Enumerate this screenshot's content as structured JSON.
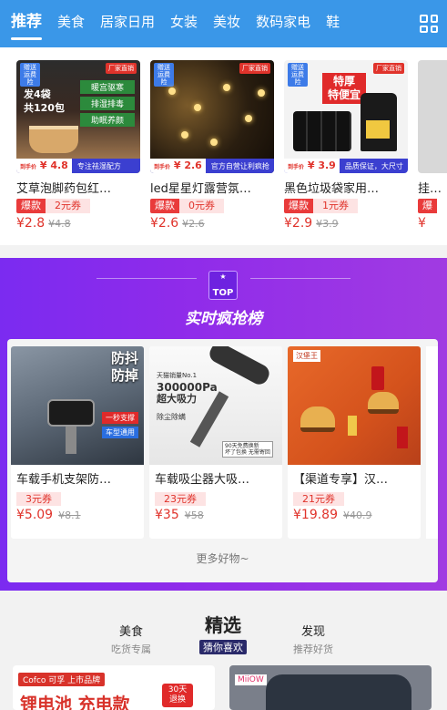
{
  "topnav": {
    "tabs": [
      "推荐",
      "美食",
      "居家日用",
      "女装",
      "美妆",
      "数码家电",
      "鞋"
    ],
    "active": "推荐",
    "grid_icon": "grid-menu-icon"
  },
  "products": [
    {
      "title": "艾草泡脚药包红…",
      "img_lines": [
        "发4袋",
        "共120包"
      ],
      "img_tags": [
        "暖宫驱寒",
        "排湿排毒",
        "助眠养颜"
      ],
      "img_badge_left": "赠送运费险",
      "img_badge_right": "厂家直销",
      "img_price_prefix": "到手价",
      "img_price": "¥ 4.8",
      "img_slogan": "专注祛湿配方",
      "hot": "爆款",
      "coupon": "2元券",
      "price": "¥2.8",
      "old_price": "¥4.8"
    },
    {
      "title": "led星星灯露营氛…",
      "img_badge_left": "赠送运费险",
      "img_badge_right": "厂家直销",
      "img_price_prefix": "到手价",
      "img_price": "¥ 2.6",
      "img_slogan": "官方自营让利疯抢",
      "hot": "爆款",
      "coupon": "0元券",
      "price": "¥2.6",
      "old_price": "¥2.6"
    },
    {
      "title": "黑色垃圾袋家用…",
      "img_lines": [
        "特厚",
        "特便宜"
      ],
      "img_badge_left": "赠送运费险",
      "img_badge_right": "厂家直销",
      "img_price_prefix": "到手价",
      "img_price": "¥ 3.9",
      "img_slogan": "品质保证，大尺寸",
      "hot": "爆款",
      "coupon": "1元券",
      "price": "¥2.9",
      "old_price": "¥3.9"
    },
    {
      "title": "挂…",
      "hot": "爆",
      "price": "¥"
    }
  ],
  "ranking": {
    "badge_top": "TOP",
    "title": "实时疯抢榜",
    "items": [
      {
        "title": "车载手机支架防…",
        "img_text": [
          "防抖",
          "防掉"
        ],
        "img_tags": [
          "一秒支撑",
          "车型通用"
        ],
        "coupon": "3元券",
        "price": "¥5.09",
        "old_price": "¥8.1"
      },
      {
        "title": "车载吸尘器大吸…",
        "img_text": [
          "天猫销量No.1",
          "300000Pa",
          "超大吸力",
          "除尘除螨",
          "90天免费换新",
          "坏了包换 无需寄回"
        ],
        "coupon": "23元券",
        "price": "¥35",
        "old_price": "¥58"
      },
      {
        "title": "【渠道专享】汉…",
        "img_text": [
          "汉堡王"
        ],
        "coupon": "21元券",
        "price": "¥19.89",
        "old_price": "¥40.9"
      }
    ],
    "more": "更多好物~"
  },
  "feed_tabs": [
    {
      "label": "美食",
      "sub": "吃货专属"
    },
    {
      "label": "精选",
      "sub": "猜你喜欢",
      "active": true
    },
    {
      "label": "发现",
      "sub": "推荐好货"
    }
  ],
  "bottom_cards": [
    {
      "brand": "Cofco 可孚 上市品牌",
      "text": "锂电池 充电款",
      "tag": "30天 退换"
    },
    {
      "brand": "MiiOW"
    }
  ]
}
